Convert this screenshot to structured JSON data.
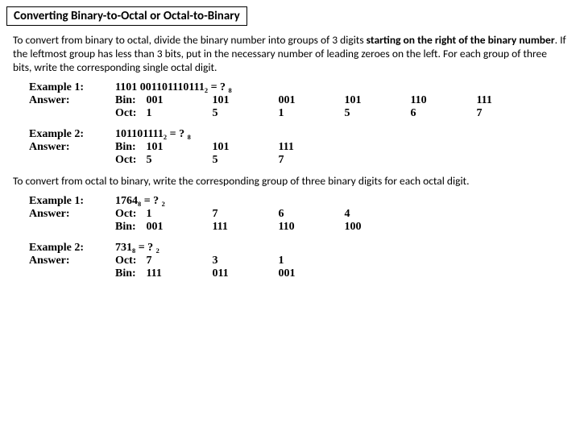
{
  "title": "Converting Binary-to-Octal or Octal-to-Binary",
  "para1": {
    "pre": "To convert from binary to octal, divide the binary number into groups of 3 digits ",
    "bold": "starting on the right of the binary number",
    "post": ". If the leftmost group has less than 3 bits, put in the necessary number of leading zeroes on the left. For each group of three bits, write the corresponding single octal digit."
  },
  "ex1": {
    "label": "Example 1:",
    "answer": "Answer:",
    "question": "1101 001101110111₂ = ? ₈",
    "r1lab": "Bin:",
    "r1": [
      "001",
      "101",
      "001",
      "101",
      "110",
      "111"
    ],
    "r2lab": "Oct:",
    "r2": [
      "1",
      "5",
      "1",
      "5",
      "6",
      "7"
    ]
  },
  "ex2": {
    "label": "Example 2:",
    "answer": "Answer:",
    "question": "101101111₂ = ? ₈",
    "r1lab": "Bin:",
    "r1": [
      "101",
      "101",
      "111"
    ],
    "r2lab": "Oct:",
    "r2": [
      "5",
      "5",
      "7"
    ]
  },
  "para2": "To convert from octal to binary, write the corresponding group of three binary digits for each octal digit.",
  "ex3": {
    "label": "Example 1:",
    "answer": "Answer:",
    "question": "1764₈ = ? ₂",
    "r1lab": "Oct:",
    "r1": [
      "1",
      "7",
      "6",
      "4"
    ],
    "r2lab": "Bin:",
    "r2": [
      "001",
      "111",
      "110",
      "100"
    ]
  },
  "ex4": {
    "label": "Example 2:",
    "answer": "Answer:",
    "question": "731₈ = ? ₂",
    "r1lab": "Oct:",
    "r1": [
      "7",
      "3",
      "1"
    ],
    "r2lab": "Bin:",
    "r2": [
      "111",
      "011",
      "001"
    ]
  }
}
